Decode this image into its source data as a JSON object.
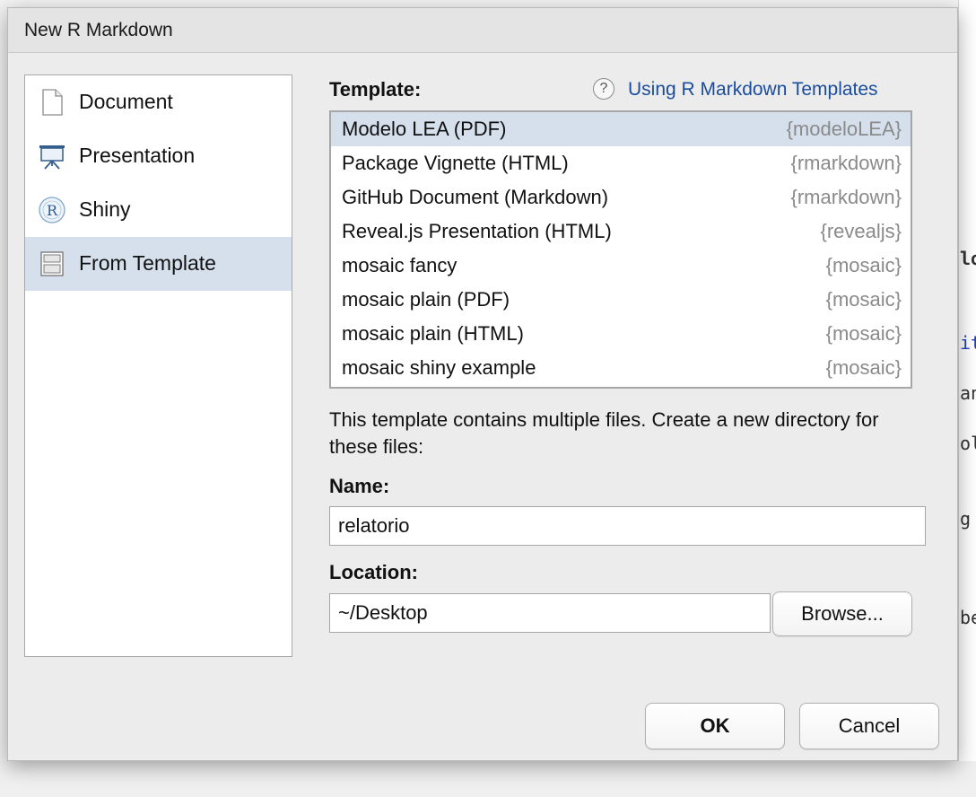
{
  "dialog": {
    "title": "New R Markdown",
    "types": [
      {
        "label": "Document",
        "icon": "document-icon",
        "selected": false
      },
      {
        "label": "Presentation",
        "icon": "presentation-icon",
        "selected": false
      },
      {
        "label": "Shiny",
        "icon": "shiny-r-icon",
        "selected": false
      },
      {
        "label": "From Template",
        "icon": "template-icon",
        "selected": true
      }
    ],
    "template_label": "Template:",
    "help_link": "Using R Markdown Templates",
    "help_icon": "question-circle-icon",
    "templates": [
      {
        "name": "Modelo LEA (PDF)",
        "package": "{modeloLEA}",
        "selected": true
      },
      {
        "name": "Package Vignette (HTML)",
        "package": "{rmarkdown}",
        "selected": false
      },
      {
        "name": "GitHub Document (Markdown)",
        "package": "{rmarkdown}",
        "selected": false
      },
      {
        "name": "Reveal.js Presentation (HTML)",
        "package": "{revealjs}",
        "selected": false
      },
      {
        "name": "mosaic fancy",
        "package": "{mosaic}",
        "selected": false
      },
      {
        "name": "mosaic plain (PDF)",
        "package": "{mosaic}",
        "selected": false
      },
      {
        "name": "mosaic plain (HTML)",
        "package": "{mosaic}",
        "selected": false
      },
      {
        "name": "mosaic shiny example",
        "package": "{mosaic}",
        "selected": false
      }
    ],
    "description": "This template contains multiple files. Create a new directory for these files:",
    "name_label": "Name:",
    "name_value": "relatorio",
    "location_label": "Location:",
    "location_value": "~/Desktop",
    "browse_label": "Browse...",
    "ok_label": "OK",
    "cancel_label": "Cancel"
  },
  "background_fragments": [
    "lo",
    "it",
    "an",
    "ol",
    "g",
    "be"
  ],
  "colors": {
    "selection": "#d5e0ec",
    "link": "#1a4c9c",
    "package": "#8a8a8a"
  }
}
